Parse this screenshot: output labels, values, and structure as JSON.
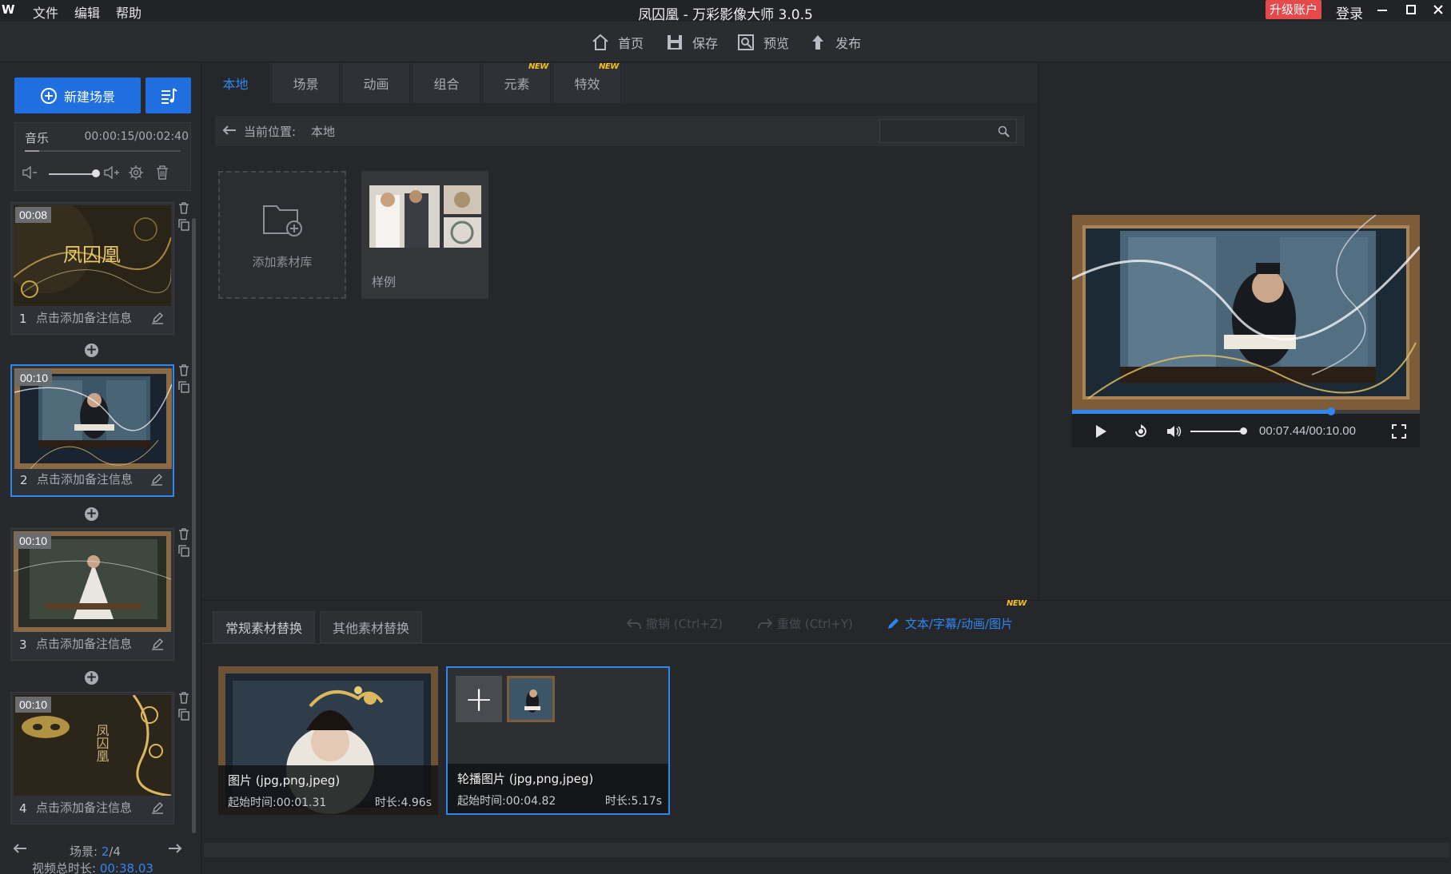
{
  "app": {
    "logo": "W",
    "title": "凤囚凰 - 万彩影像大师 3.0.5",
    "menu": [
      "文件",
      "编辑",
      "帮助"
    ],
    "upgrade": "升级账户",
    "login": "登录"
  },
  "toolbar": {
    "home": "首页",
    "save": "保存",
    "preview": "预览",
    "publish": "发布"
  },
  "left": {
    "new_scene": "新建场景",
    "music": {
      "label": "音乐",
      "time": "00:00:15/00:02:40",
      "progress": 0.09
    },
    "scenes": [
      {
        "index": "1",
        "duration": "00:08",
        "note": "点击添加备注信息",
        "thumb_text": "凤囚凰"
      },
      {
        "index": "2",
        "duration": "00:10",
        "note": "点击添加备注信息"
      },
      {
        "index": "3",
        "duration": "00:10",
        "note": "点击添加备注信息"
      },
      {
        "index": "4",
        "duration": "00:10",
        "note": "点击添加备注信息",
        "thumb_text": "凤囚凰"
      }
    ],
    "footer": {
      "scene_label": "场景: ",
      "scene_current": "2",
      "scene_total": "/4",
      "total_label": "视频总时长: ",
      "total_value": "00:38.03"
    }
  },
  "library": {
    "tabs": [
      "本地",
      "场景",
      "动画",
      "组合",
      "元素",
      "特效"
    ],
    "active_tab": "本地",
    "new_badge": "NEW",
    "path_label": "当前位置:",
    "path_value": "本地",
    "search_placeholder": "",
    "items": [
      {
        "label": "添加素材库"
      },
      {
        "label": "样例"
      }
    ]
  },
  "preview": {
    "time": "00:07.44/00:10.00",
    "progress": 0.744
  },
  "replace": {
    "tabs": [
      "常规素材替换",
      "其他素材替换"
    ],
    "undo": "撤销 (Ctrl+Z)",
    "redo": "重做 (Ctrl+Y)",
    "text_edit": "文本/字幕/动画/图片",
    "new_badge": "NEW",
    "cards": [
      {
        "title": "图片 (jpg,png,jpeg)",
        "start": "起始时间:00:01.31",
        "duration": "时长:4.96s"
      },
      {
        "title": "轮播图片 (jpg,png,jpeg)",
        "start": "起始时间:00:04.82",
        "duration": "时长:5.17s"
      }
    ]
  },
  "colors": {
    "accent": "#2f86ef",
    "upgrade": "#e5494a",
    "new_badge": "#f4c21a"
  }
}
